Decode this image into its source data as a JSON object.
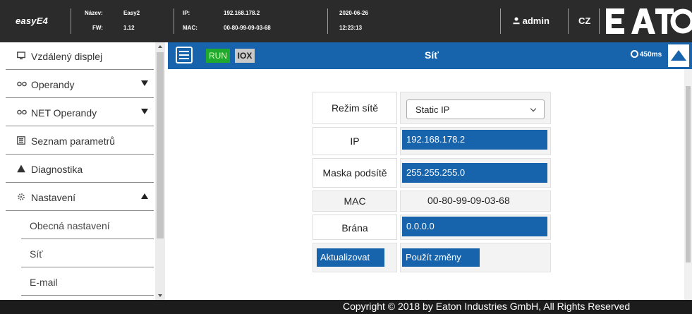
{
  "header": {
    "brand": "easyE4",
    "name_label": "Název:",
    "name_value": "Easy2",
    "fw_label": "FW:",
    "fw_value": "1.12",
    "ip_label": "IP:",
    "ip_value": "192.168.178.2",
    "mac_label": "MAC:",
    "mac_value": "00-80-99-09-03-68",
    "date": "2020-06-26",
    "time": "12:23:13",
    "user": "admin",
    "language": "CZ",
    "logo_text": "EATON"
  },
  "sidebar": {
    "items": [
      {
        "label": "Vzdálený displej",
        "icon": "monitor-icon"
      },
      {
        "label": "Operandy",
        "icon": "link-icon",
        "expand": "down"
      },
      {
        "label": "NET Operandy",
        "icon": "link-icon",
        "expand": "down"
      },
      {
        "label": "Seznam parametrů",
        "icon": "list-icon"
      },
      {
        "label": "Diagnostika",
        "icon": "warning-icon"
      },
      {
        "label": "Nastavení",
        "icon": "gear-icon",
        "expand": "up"
      }
    ],
    "subitems": [
      {
        "label": "Obecná nastavení"
      },
      {
        "label": "Síť"
      },
      {
        "label": "E-mail"
      }
    ]
  },
  "toolbar": {
    "run_label": "RUN",
    "iox_label": "IOX",
    "title": "Síť",
    "cycle_time": "450ms"
  },
  "network_form": {
    "mode_label": "Režim sítě",
    "mode_value": "Static IP",
    "ip_label": "IP",
    "ip_value": "192.168.178.2",
    "mask_label": "Maska podsítě",
    "mask_value": "255.255.255.0",
    "mac_label": "MAC",
    "mac_value": "00-80-99-09-03-68",
    "gateway_label": "Brána",
    "gateway_value": "0.0.0.0",
    "refresh_button": "Aktualizovat",
    "apply_button": "Použít změny"
  },
  "footer": {
    "copyright": "Copyright © 2018 by Eaton Industries GmbH, All Rights Reserved"
  },
  "colors": {
    "header_bg": "#2b2b2b",
    "accent_blue": "#1764ad",
    "run_green": "#1faa2e",
    "footer_bg": "#1c1c1c"
  }
}
